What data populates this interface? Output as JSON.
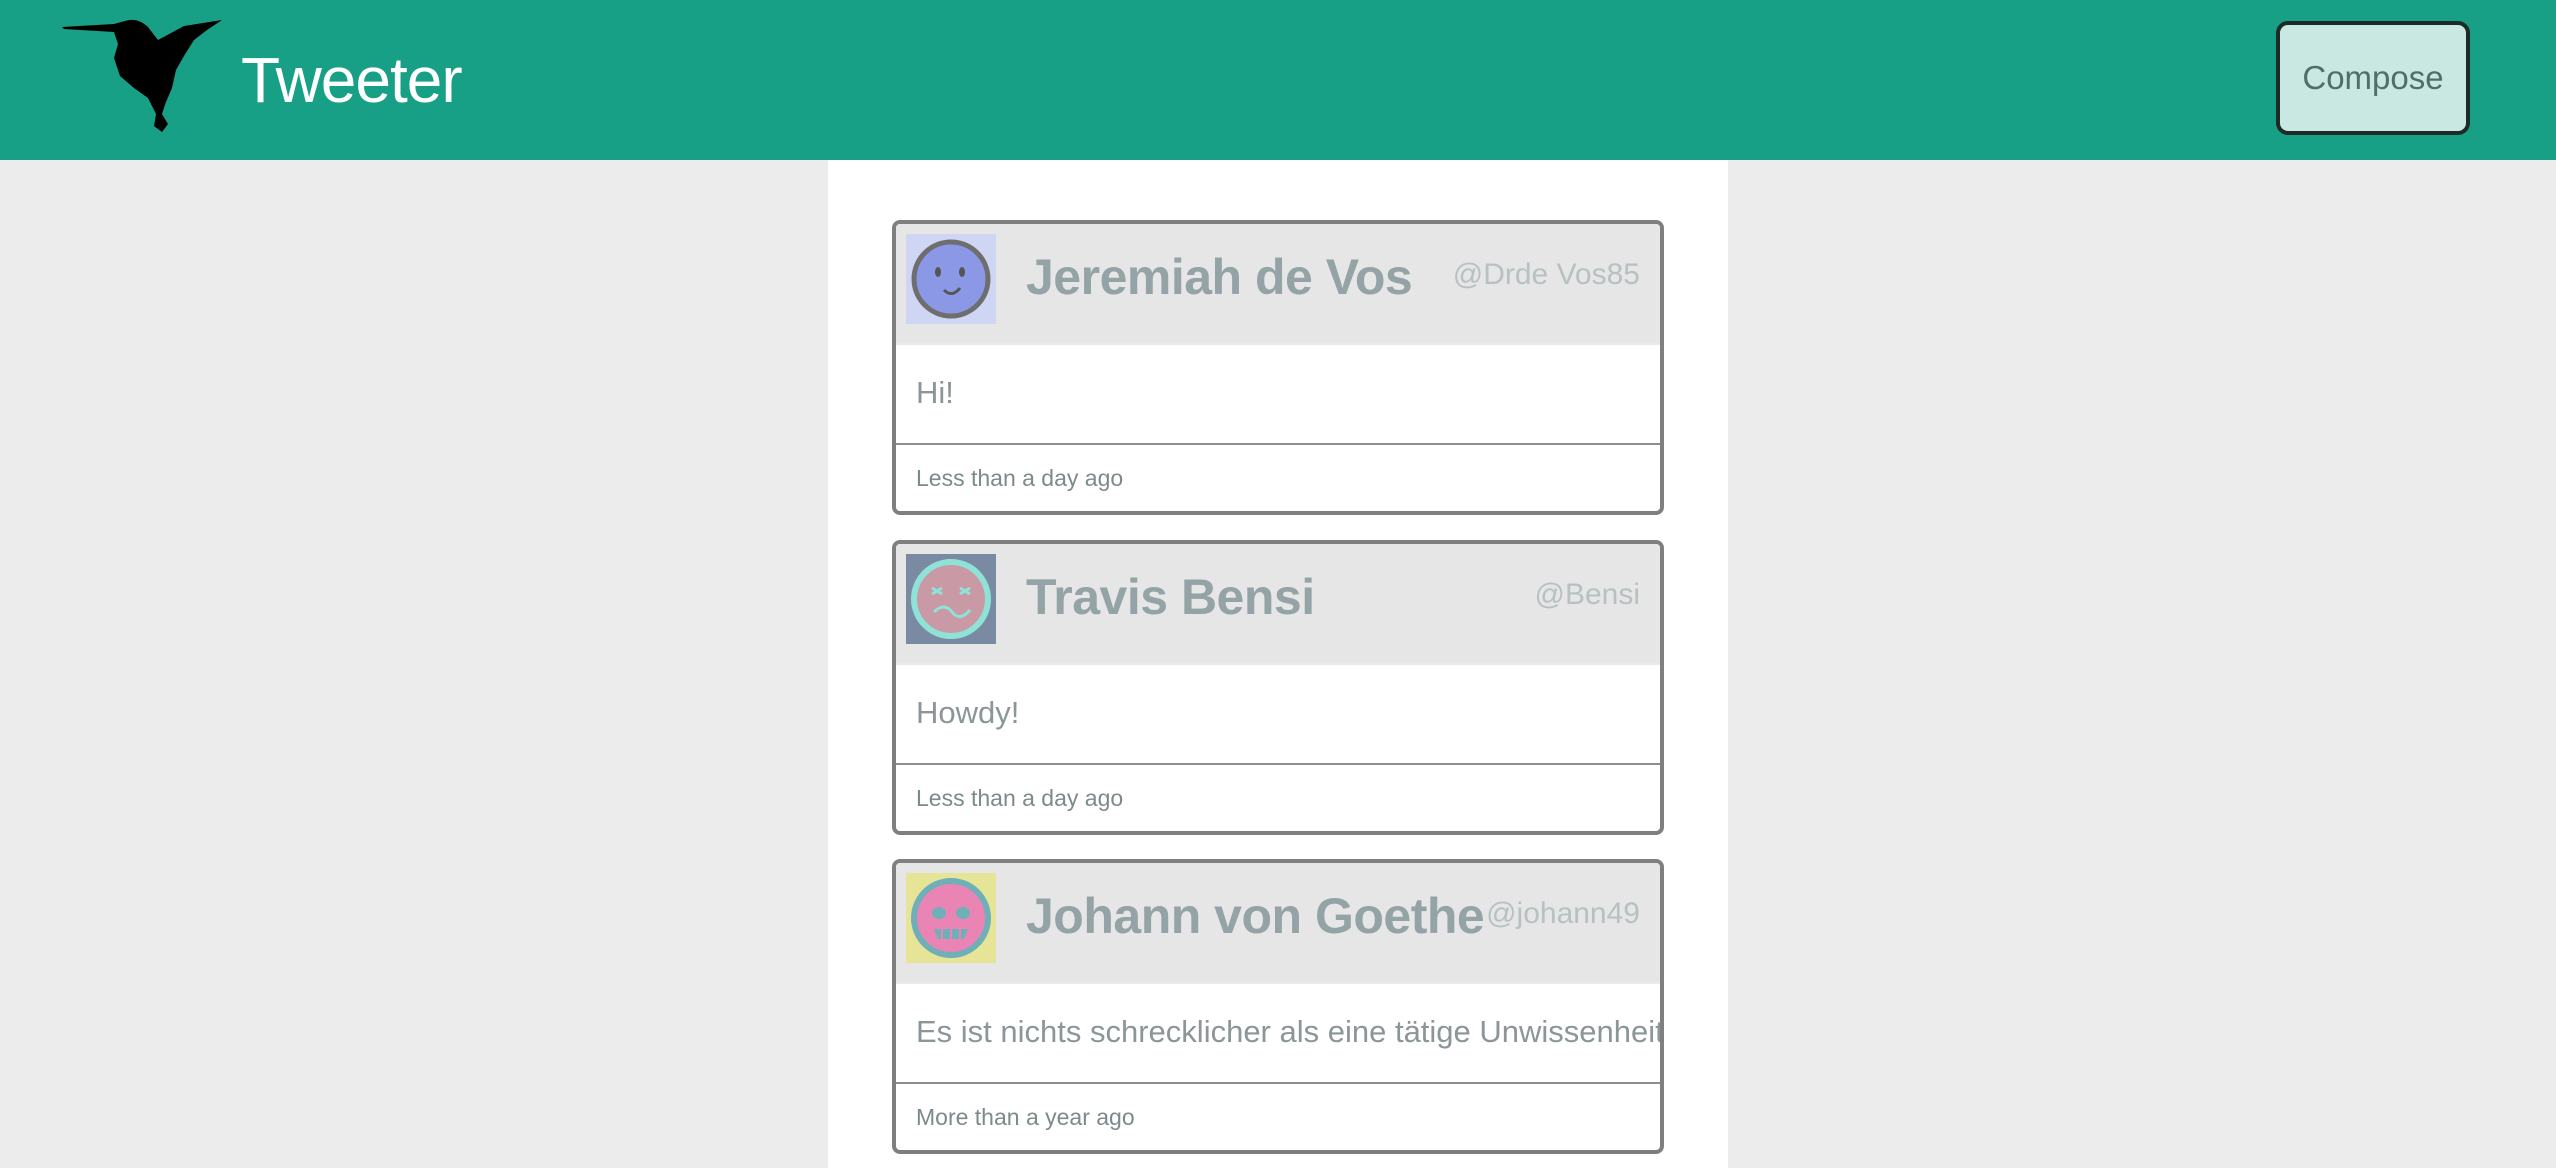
{
  "header": {
    "brand": "Tweeter",
    "logo_icon": "hummingbird-icon",
    "compose_label": "Compose"
  },
  "tweets": [
    {
      "name": "Jeremiah de Vos",
      "handle": "@Drde Vos85",
      "content": "Hi!",
      "timestamp": "Less than a day ago",
      "avatar_icon": "smiley-face-avatar",
      "avatar_bg": "#cfd6f4",
      "avatar_fg": "#8a98e6"
    },
    {
      "name": "Travis Bensi",
      "handle": "@Bensi",
      "content": "Howdy!",
      "timestamp": "Less than a day ago",
      "avatar_icon": "dizzy-face-avatar",
      "avatar_bg": "#7b8aa3",
      "avatar_fg": "#8ee3d6"
    },
    {
      "name": "Johann von Goethe",
      "handle": "@johann49",
      "content": "Es ist nichts schrecklicher als eine tätige Unwissenheit.",
      "timestamp": "More than a year ago",
      "avatar_icon": "skull-face-avatar",
      "avatar_bg": "#e6e597",
      "avatar_fg": "#ea84b5"
    }
  ],
  "colors": {
    "nav_bg": "#18a087",
    "page_bg": "#ececec",
    "compose_bg": "#c8e8e1"
  }
}
